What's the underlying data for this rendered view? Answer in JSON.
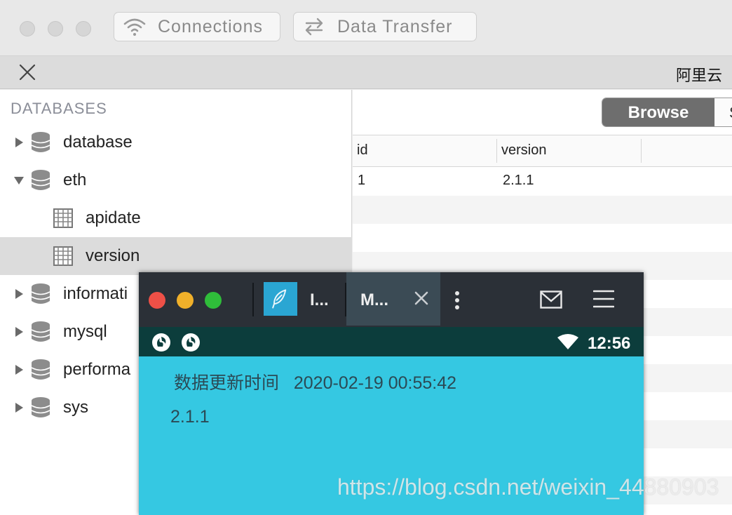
{
  "toolbar": {
    "connections_label": "Connections",
    "data_transfer_label": "Data Transfer"
  },
  "connection_bar": {
    "connection_name": "阿里云"
  },
  "sidebar": {
    "header": "DATABASES",
    "items": [
      {
        "label": "database",
        "type": "database",
        "expanded": false
      },
      {
        "label": "eth",
        "type": "database",
        "expanded": true
      },
      {
        "label": "apidate",
        "type": "table"
      },
      {
        "label": "version",
        "type": "table",
        "selected": true
      },
      {
        "label": "informati",
        "type": "database",
        "expanded": false
      },
      {
        "label": "mysql",
        "type": "database",
        "expanded": false
      },
      {
        "label": "performa",
        "type": "database",
        "expanded": false
      },
      {
        "label": "sys",
        "type": "database",
        "expanded": false
      }
    ]
  },
  "content": {
    "browse_label": "Browse",
    "next_segment_label": "S",
    "columns": [
      "id",
      "version"
    ],
    "rows": [
      [
        "1",
        "2.1.1"
      ]
    ]
  },
  "phone": {
    "tab1_label": "I...",
    "tab2_label": "M...",
    "time": "12:56",
    "update_label": "数据更新时间",
    "update_time": "2020-02-19 00:55:42",
    "version_value": "2.1.1"
  },
  "watermark": "https://blog.csdn.net/weixin_44880903",
  "colors": {
    "phone_background": "#35c8e2",
    "phone_titlebar": "#2b3037",
    "status_bar": "#0c3d3c",
    "browse_button": "#6e6e6e"
  },
  "icons": {
    "connections": "wifi-icon",
    "data_transfer": "transfer-arrows-icon",
    "close": "close-icon",
    "database": "database-cylinder-icon",
    "table": "table-grid-icon",
    "mail": "mail-icon",
    "menu": "hamburger-menu-icon"
  }
}
